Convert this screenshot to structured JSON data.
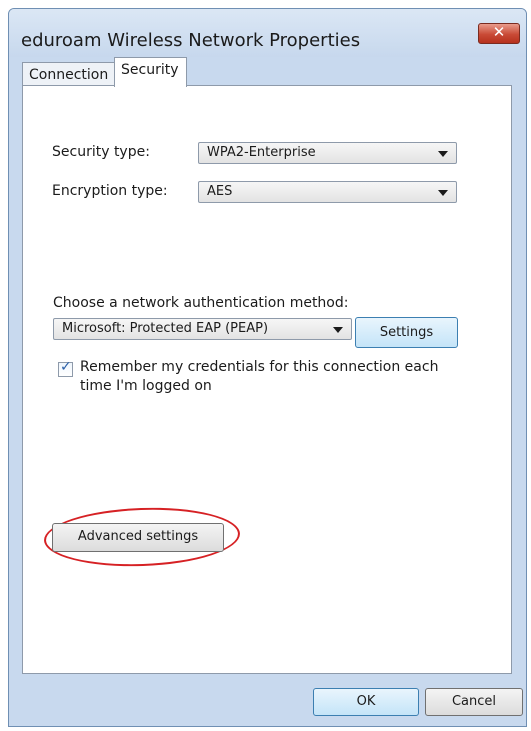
{
  "window": {
    "title": "eduroam Wireless Network Properties",
    "close_glyph": "✕"
  },
  "tabs": [
    {
      "label": "Connection"
    },
    {
      "label": "Security"
    }
  ],
  "security": {
    "security_type_label": "Security type:",
    "security_type_value": "WPA2-Enterprise",
    "encryption_type_label": "Encryption type:",
    "encryption_type_value": "AES",
    "auth_method_label": "Choose a network authentication method:",
    "auth_method_value": "Microsoft: Protected EAP (PEAP)",
    "settings_button": "Settings",
    "remember_line1": "Remember my credentials for this connection each",
    "remember_line2": "time I'm logged on",
    "remember_checked": true,
    "advanced_button": "Advanced settings"
  },
  "footer": {
    "ok_button": "OK",
    "cancel_button": "Cancel"
  },
  "colors": {
    "highlight_ring": "#d62124",
    "close_button": "#c94a36"
  },
  "icons": {
    "close": "close-icon",
    "dropdown": "chevron-down-icon",
    "check": "checkmark-icon"
  }
}
